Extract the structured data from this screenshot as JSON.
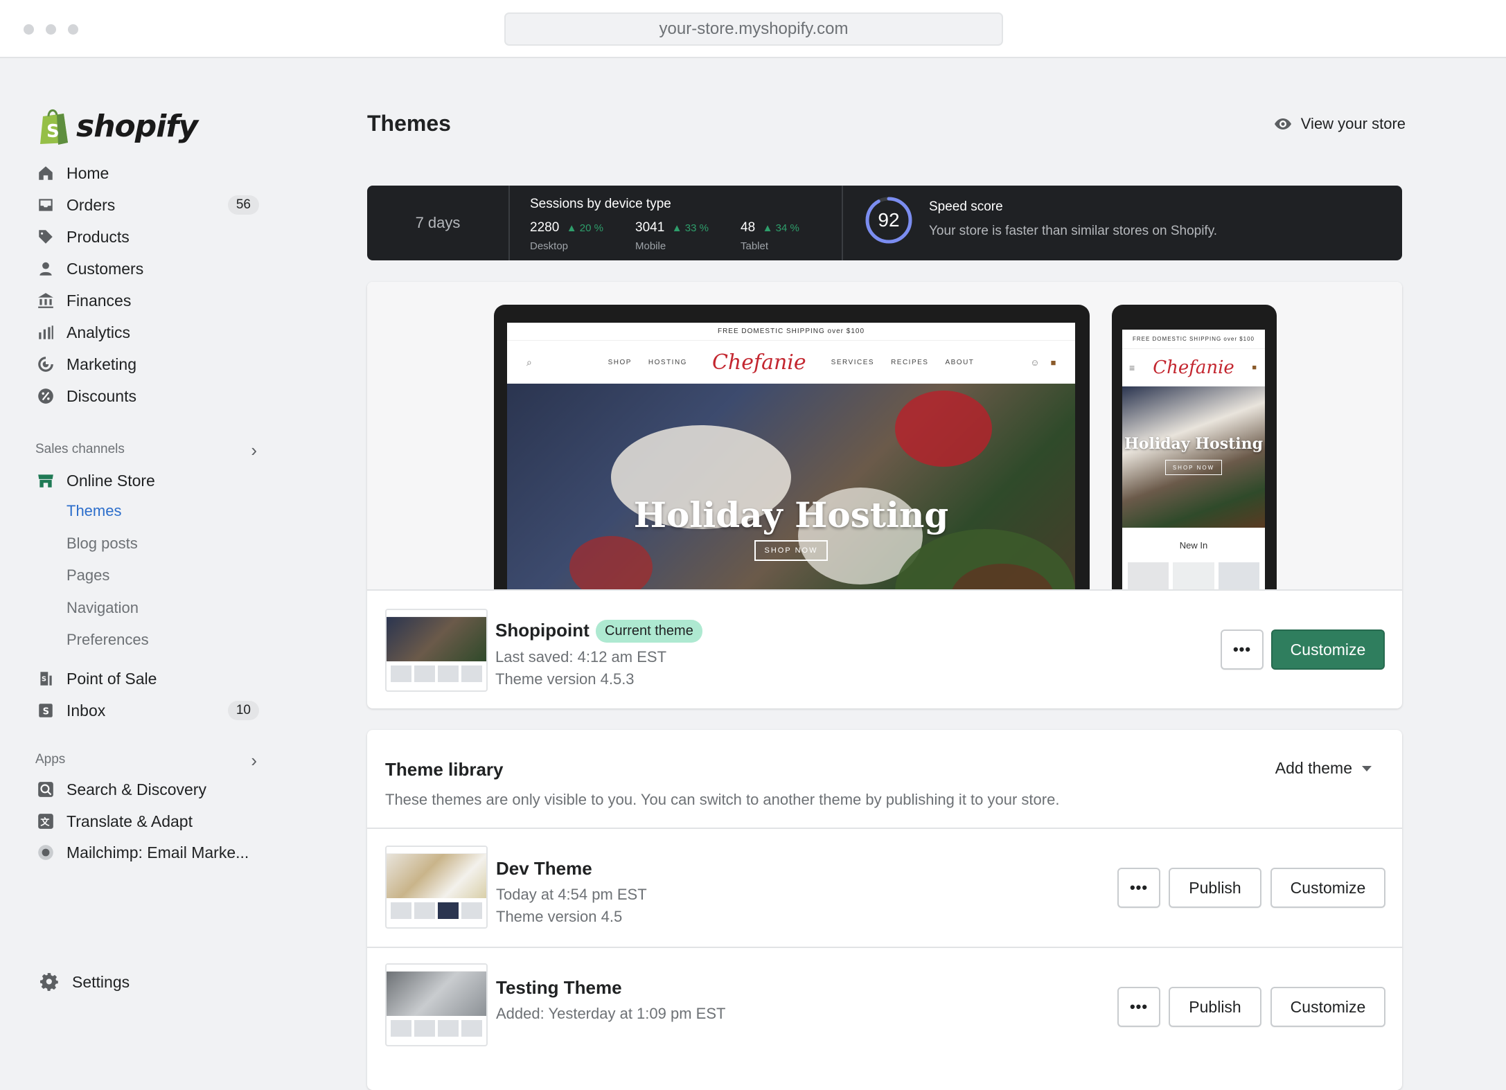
{
  "browser": {
    "url": "your-store.myshopify.com"
  },
  "sidebar": {
    "logo_text": "shopify",
    "items": [
      {
        "label": "Home",
        "icon": "home-icon"
      },
      {
        "label": "Orders",
        "icon": "inbox-tray-icon",
        "badge": "56"
      },
      {
        "label": "Products",
        "icon": "tag-icon"
      },
      {
        "label": "Customers",
        "icon": "person-icon"
      },
      {
        "label": "Finances",
        "icon": "bank-icon"
      },
      {
        "label": "Analytics",
        "icon": "bar-chart-icon"
      },
      {
        "label": "Marketing",
        "icon": "target-icon"
      },
      {
        "label": "Discounts",
        "icon": "discount-icon"
      }
    ],
    "sales_channels": {
      "heading": "Sales channels",
      "online_store": "Online Store",
      "sub_items": [
        "Themes",
        "Blog posts",
        "Pages",
        "Navigation",
        "Preferences"
      ],
      "point_of_sale": "Point of Sale",
      "inbox": "Inbox",
      "inbox_badge": "10"
    },
    "apps": {
      "heading": "Apps",
      "items": [
        "Search & Discovery",
        "Translate & Adapt",
        "Mailchimp: Email Marke..."
      ]
    },
    "settings": "Settings"
  },
  "header": {
    "title": "Themes",
    "view_store": "View your store"
  },
  "stats": {
    "period": "7 days",
    "sessions_title": "Sessions by device type",
    "metrics": [
      {
        "value": "2280",
        "change": "20 %",
        "label": "Desktop"
      },
      {
        "value": "3041",
        "change": "33 %",
        "label": "Mobile"
      },
      {
        "value": "48",
        "change": "34 %",
        "label": "Tablet"
      }
    ],
    "speed_score": "92",
    "speed_fraction": 0.92,
    "speed_title": "Speed score",
    "speed_desc": "Your store is faster than similar stores on Shopify."
  },
  "preview": {
    "promo": "FREE DOMESTIC SHIPPING over $100",
    "promo_mobile": "FREE DOMESTIC SHIPPING over $100",
    "nav_left": [
      "SHOP",
      "HOSTING"
    ],
    "nav_right": [
      "SERVICES",
      "RECIPES",
      "ABOUT"
    ],
    "brand": "Chefanie",
    "hero_title": "Holiday Hosting",
    "hero_button": "SHOP NOW",
    "mobile_section": "New In"
  },
  "current_theme": {
    "name": "Shopipoint",
    "badge": "Current theme",
    "last_saved": "Last saved: 4:12 am EST",
    "version": "Theme version 4.5.3",
    "more_label": "•••",
    "customize_label": "Customize"
  },
  "library": {
    "title": "Theme library",
    "description": "These themes are only visible to you. You can switch to another theme by publishing it to your store.",
    "add_theme": "Add theme",
    "themes": [
      {
        "name": "Dev Theme",
        "line1": "Today at 4:54 pm EST",
        "line2": "Theme version 4.5",
        "more": "•••",
        "publish": "Publish",
        "customize": "Customize"
      },
      {
        "name": "Testing Theme",
        "line1": "Added: Yesterday at 1:09 pm EST",
        "line2": "",
        "more": "•••",
        "publish": "Publish",
        "customize": "Customize"
      }
    ]
  }
}
